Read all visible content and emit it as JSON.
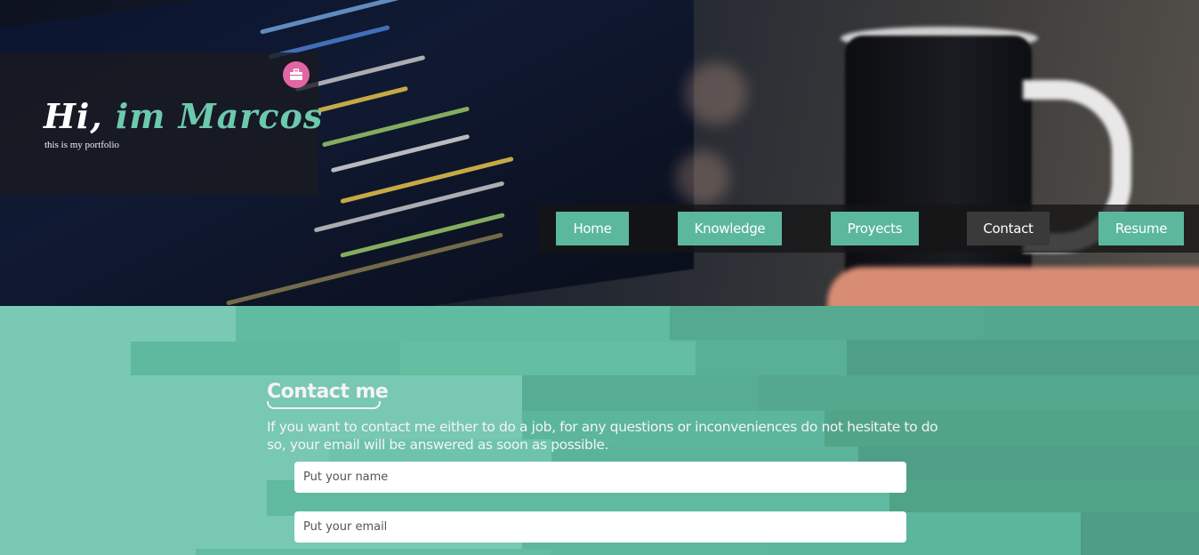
{
  "hero": {
    "title_part1": "Hi,",
    "title_part2": "im Marcos",
    "subtitle": "this is my portfolio",
    "badge_icon": "briefcase-icon"
  },
  "nav": {
    "items": [
      {
        "label": "Home",
        "active": false
      },
      {
        "label": "Knowledge",
        "active": false
      },
      {
        "label": "Proyects",
        "active": false
      },
      {
        "label": "Contact",
        "active": true
      },
      {
        "label": "Resume",
        "active": false
      }
    ]
  },
  "contact": {
    "title": "Contact me",
    "text": "If you want to contact me either to do a job, for any questions or inconveniences do not hesitate to do so, your email will be answered as soon as possible.",
    "name_placeholder": "Put your name",
    "email_placeholder": "Put your email"
  },
  "colors": {
    "accent": "#5bb89d",
    "active_nav": "#3a3a3a",
    "badge": "#e266a2"
  }
}
